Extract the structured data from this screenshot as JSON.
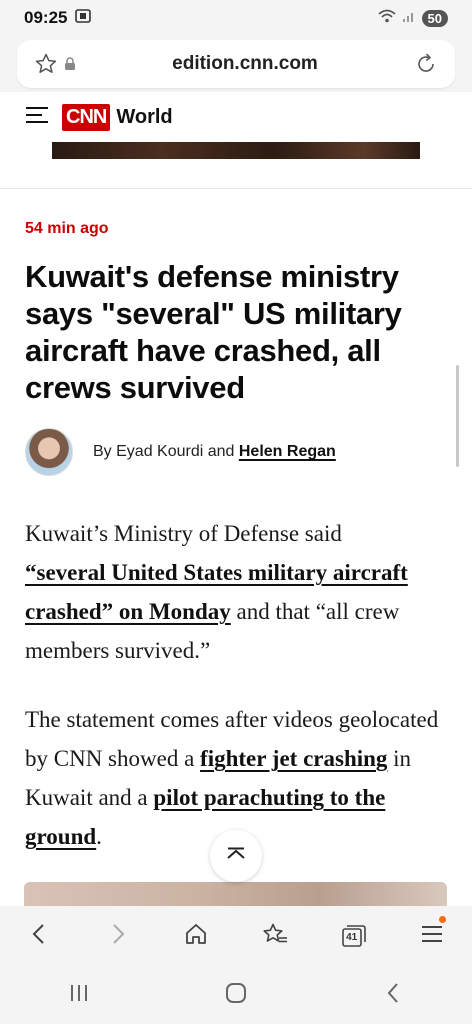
{
  "status_bar": {
    "time": "09:25",
    "battery": "50"
  },
  "browser": {
    "url": "edition.cnn.com"
  },
  "site": {
    "logo": "CNN",
    "section": "World"
  },
  "article": {
    "timestamp": "54 min ago",
    "headline": "Kuwait's defense ministry says \"several\" US military aircraft have crashed, all crews survived",
    "byline_prefix": "By Eyad Kourdi and",
    "byline_author_link": "Helen Regan",
    "p1_text_a": "Kuwait’s Ministry of Defense said",
    "p1_link": "“several United States military aircraft crashed” on Monday",
    "p1_text_b": " and that “all crew members survived.”",
    "p2_text_a": "The statement comes after videos geolocated by CNN showed a ",
    "p2_link_1": "fighter jet crashing",
    "p2_text_b": " in Kuwait and a ",
    "p2_link_2": "pilot parachuting to the ground",
    "p2_text_c": "."
  },
  "toolbar": {
    "tab_count": "41"
  },
  "colors": {
    "accent": "#cc0000",
    "notification_dot": "#f26b21"
  }
}
